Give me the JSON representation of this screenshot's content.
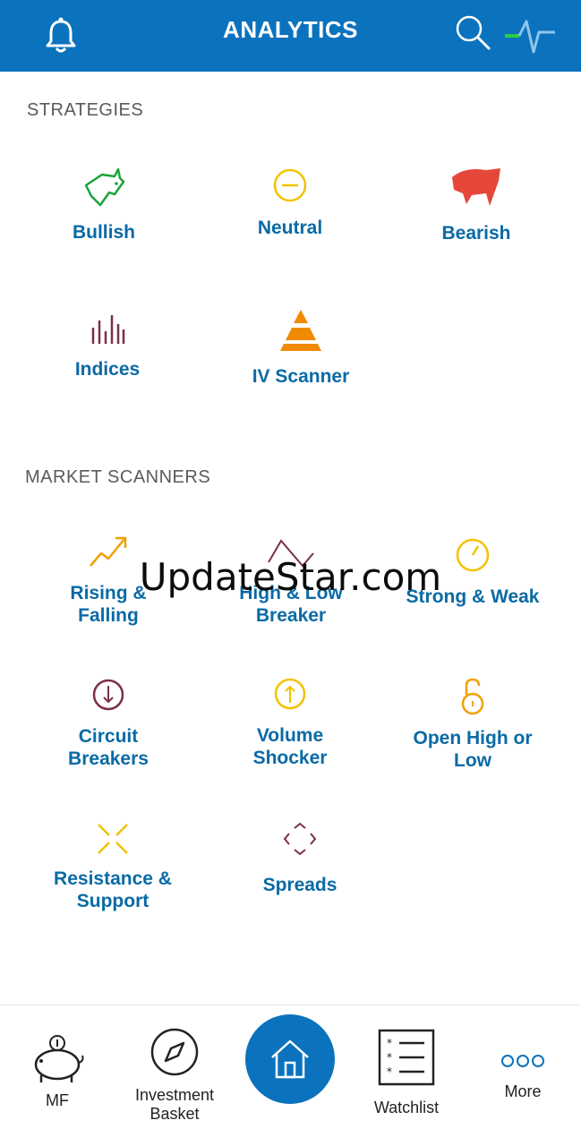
{
  "header": {
    "title": "ANALYTICS",
    "icons": [
      "bell-icon",
      "search-icon",
      "pulse-icon"
    ]
  },
  "strategies": {
    "title": "STRATEGIES",
    "items": [
      {
        "label": "Bullish",
        "icon": "bull-icon",
        "color": "#1aa33a"
      },
      {
        "label": "Neutral",
        "icon": "neutral-icon",
        "color": "#f2c200"
      },
      {
        "label": "Bearish",
        "icon": "bear-icon",
        "color": "#e5483a"
      },
      {
        "label": "Indices",
        "icon": "bars-icon",
        "color": "#7a2f4c"
      },
      {
        "label": "IV Scanner",
        "icon": "pyramid-icon",
        "color": "#f08a00"
      }
    ]
  },
  "scanners": {
    "title": "MARKET SCANNERS",
    "items": [
      {
        "label1": "Rising &",
        "label2": "Falling",
        "icon": "trend-up-icon",
        "color": "#f0a000"
      },
      {
        "label1": "High & Low",
        "label2": "Breaker",
        "icon": "zigzag-icon",
        "color": "#7a2f4c"
      },
      {
        "label1": "Strong & Weak",
        "icon": "gauge-icon",
        "color": "#f2c200"
      },
      {
        "label1": "Circuit",
        "label2": "Breakers",
        "icon": "circuit-down-icon",
        "color": "#7a2f4c"
      },
      {
        "label1": "Volume",
        "label2": "Shocker",
        "icon": "volume-up-icon",
        "color": "#f2c200"
      },
      {
        "label1": "Open High or",
        "label2": "Low",
        "icon": "open-lock-icon",
        "color": "#f0a000"
      },
      {
        "label1": "Resistance &",
        "label2": "Support",
        "icon": "arrows-in-icon",
        "color": "#f2c200"
      },
      {
        "label1": "Spreads",
        "icon": "diamond-arrows-icon",
        "color": "#7a2f4c"
      }
    ]
  },
  "watermark": "UpdateStar.com",
  "bottom_nav": {
    "mf": "MF",
    "investment_basket_1": "Investment",
    "investment_basket_2": "Basket",
    "watchlist": "Watchlist",
    "more": "More"
  },
  "colors": {
    "brand_blue": "#0b72bd",
    "label_blue": "#0a6aa5",
    "section_gray": "#5a5a5a"
  }
}
